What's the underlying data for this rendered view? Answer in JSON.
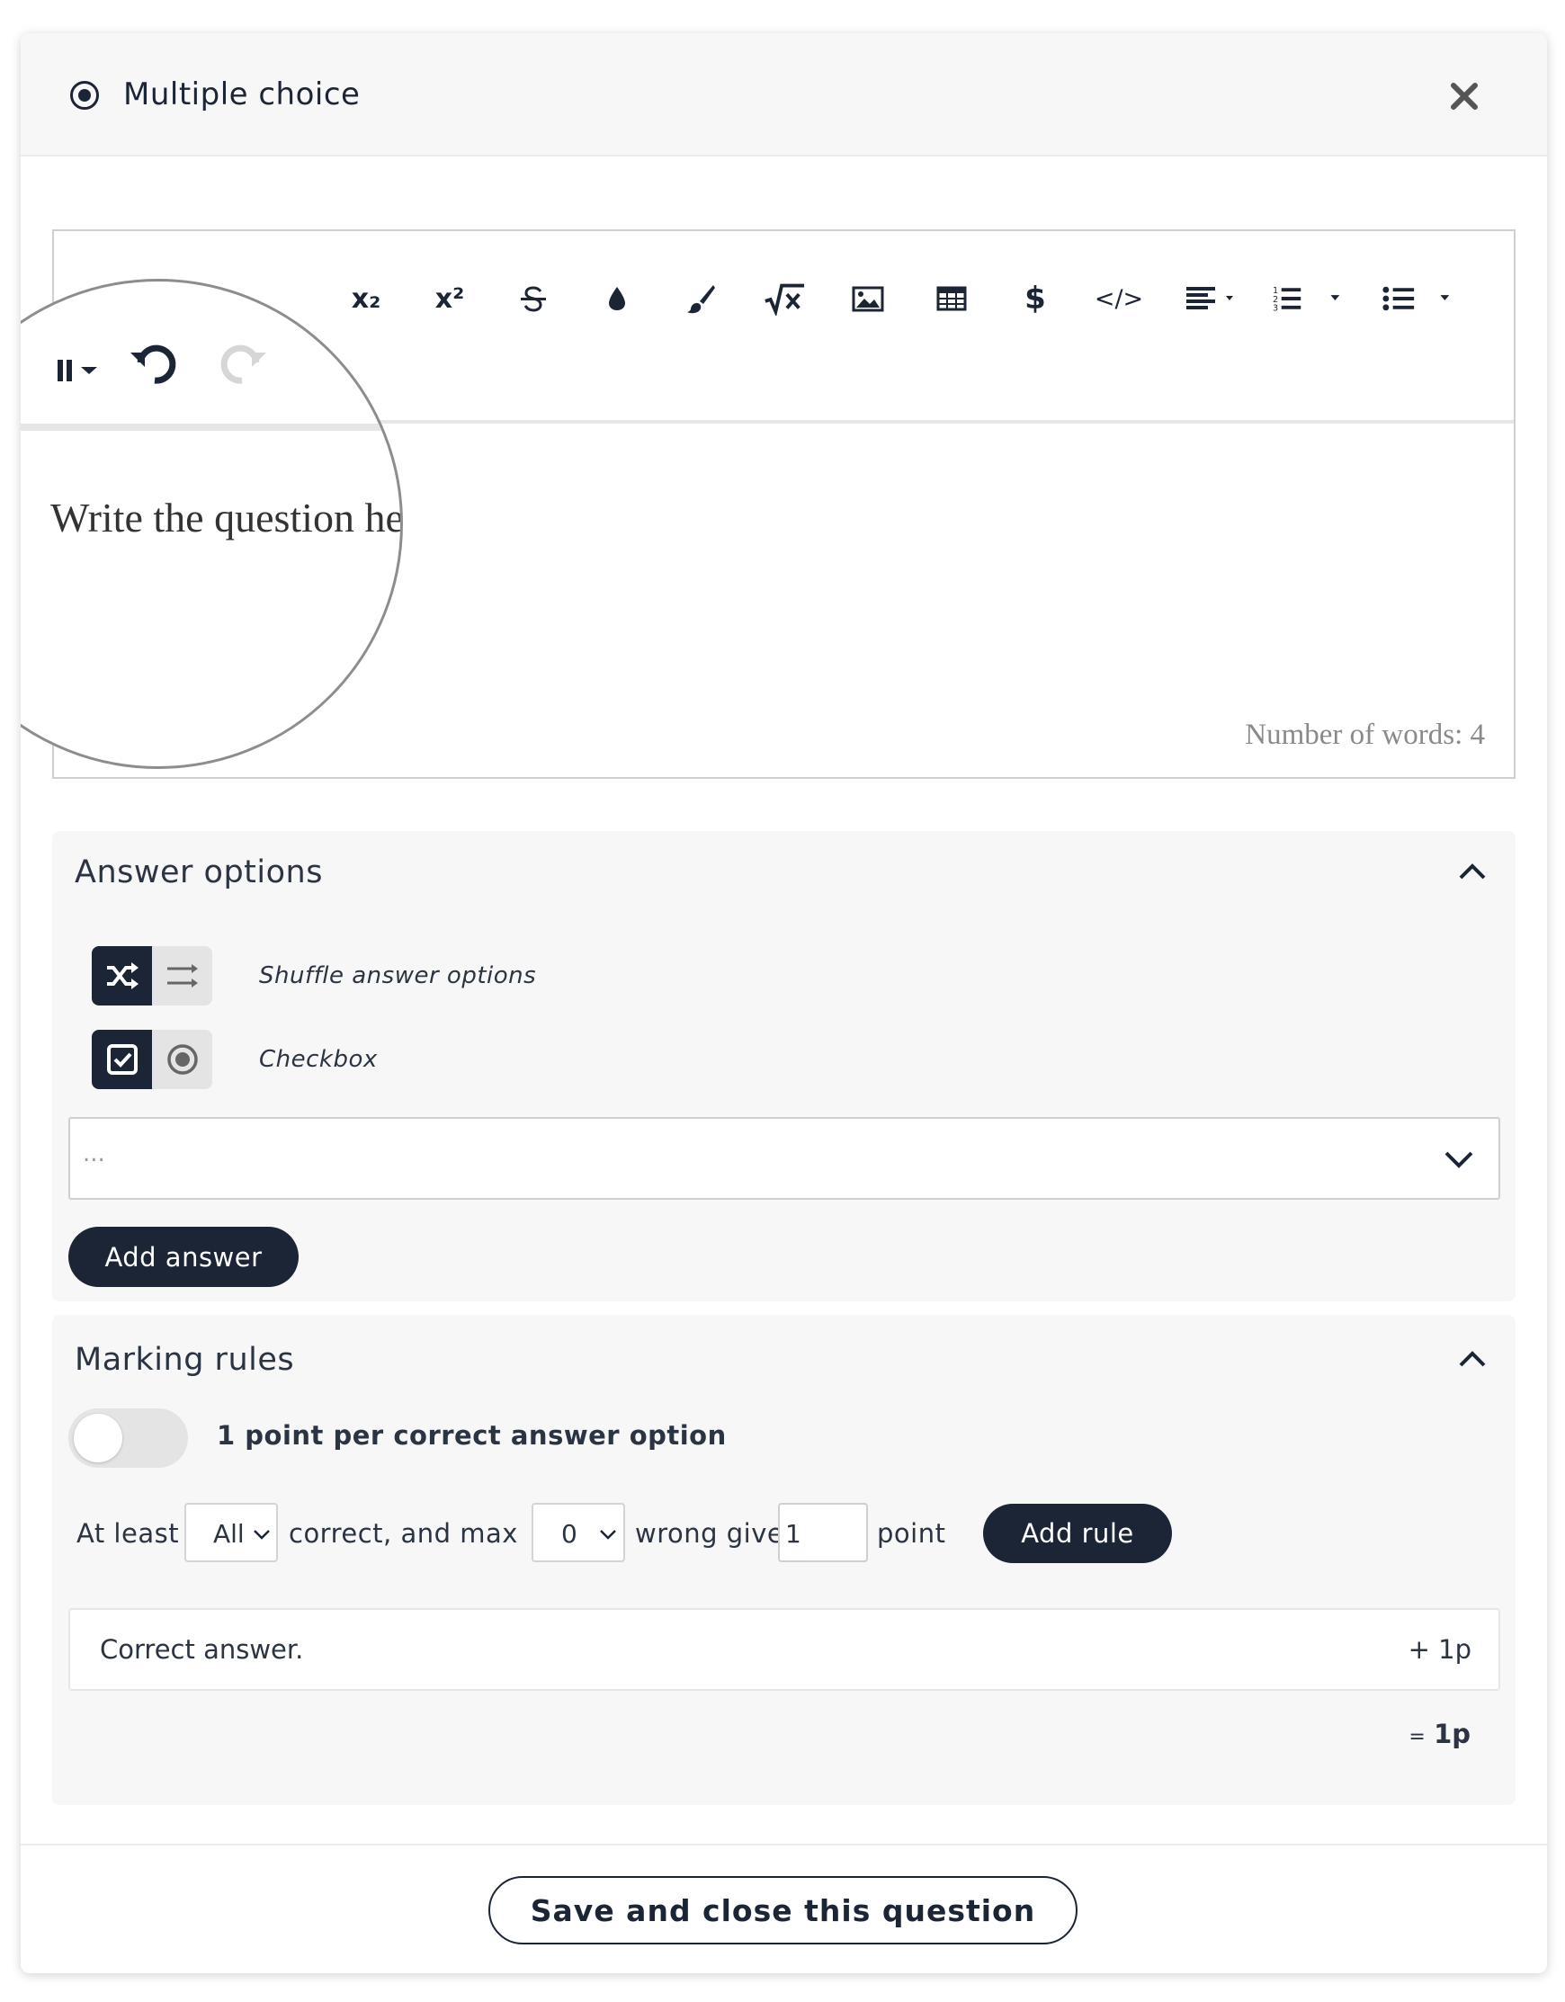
{
  "header": {
    "title": "Multiple choice",
    "close_icon": "close-icon"
  },
  "editor": {
    "toolbar": {
      "items": [
        {
          "name": "subscript",
          "label": "x₂"
        },
        {
          "name": "superscript",
          "label": "x²"
        },
        {
          "name": "strikethrough",
          "label": "S"
        },
        {
          "name": "text-color",
          "icon": "droplet-icon"
        },
        {
          "name": "background-color",
          "icon": "brush-icon"
        },
        {
          "name": "math",
          "icon": "sqrt-icon"
        },
        {
          "name": "image",
          "icon": "image-icon"
        },
        {
          "name": "table",
          "icon": "table-icon"
        },
        {
          "name": "currency",
          "label": "$"
        },
        {
          "name": "code",
          "label": "</>"
        },
        {
          "name": "align",
          "icon": "align-left-icon"
        },
        {
          "name": "ordered-list",
          "icon": "ordered-list-icon"
        },
        {
          "name": "unordered-list",
          "icon": "bullet-list-icon"
        },
        {
          "name": "undo",
          "icon": "undo-icon"
        },
        {
          "name": "redo",
          "icon": "redo-icon"
        }
      ]
    },
    "content": "Write the question here",
    "word_count": "Number of words: 4"
  },
  "answer_options": {
    "title": "Answer options",
    "shuffle_label": "Shuffle answer options",
    "checkbox_label": "Checkbox",
    "answer_placeholder": "...",
    "add_answer_label": "Add answer"
  },
  "marking_rules": {
    "title": "Marking rules",
    "switch_label": "1 point per correct answer option",
    "switch_on": false,
    "rule": {
      "at_least": "At least",
      "correct_select": "All",
      "correct_and_max": "correct, and max",
      "wrong_select": "0",
      "wrong_gives": "wrong gives",
      "points_value": "1",
      "point": "point",
      "add_rule_label": "Add rule"
    },
    "result": {
      "label": "Correct answer.",
      "points": "+ 1p"
    },
    "total_eq": "=",
    "total_value": "1p"
  },
  "footer": {
    "save_label": "Save and close this question"
  },
  "colors": {
    "primary_dark": "#1b2535",
    "panel_bg": "#f7f7f7"
  }
}
